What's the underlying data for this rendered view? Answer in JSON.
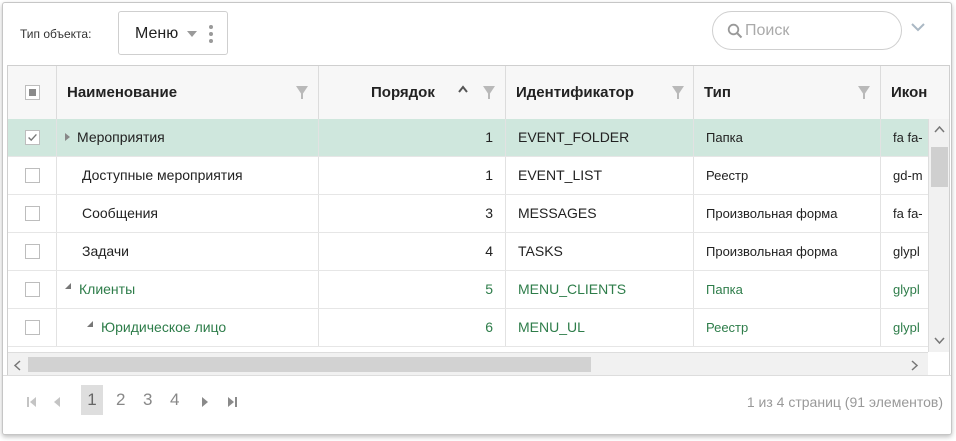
{
  "toolbar": {
    "object_type_label": "Тип объекта:",
    "object_type_value": "Меню",
    "search_placeholder": "Поиск"
  },
  "grid": {
    "columns": [
      "Наименование",
      "Порядок",
      "Идентификатор",
      "Тип",
      "Икон"
    ],
    "rows": [
      {
        "name": "Мероприятия",
        "order": "1",
        "id": "EVENT_FOLDER",
        "type": "Папка",
        "icon": "fa fa-"
      },
      {
        "name": "Доступные мероприятия",
        "order": "1",
        "id": "EVENT_LIST",
        "type": "Реестр",
        "icon": "gd-m"
      },
      {
        "name": "Сообщения",
        "order": "3",
        "id": "MESSAGES",
        "type": "Произвольная форма",
        "icon": "fa fa-"
      },
      {
        "name": "Задачи",
        "order": "4",
        "id": "TASKS",
        "type": "Произвольная форма",
        "icon": "glypl"
      },
      {
        "name": "Клиенты",
        "order": "5",
        "id": "MENU_CLIENTS",
        "type": "Папка",
        "icon": "glypl"
      },
      {
        "name": "Юридическое лицо",
        "order": "6",
        "id": "MENU_UL",
        "type": "Реестр",
        "icon": "glypl"
      }
    ]
  },
  "pager": {
    "pages": [
      "1",
      "2",
      "3",
      "4"
    ],
    "current": "1",
    "info": "1 из 4 страниц (91 элементов)"
  },
  "colors": {
    "selected_row": "#cfe7dd",
    "green_text": "#2e7d4a"
  }
}
